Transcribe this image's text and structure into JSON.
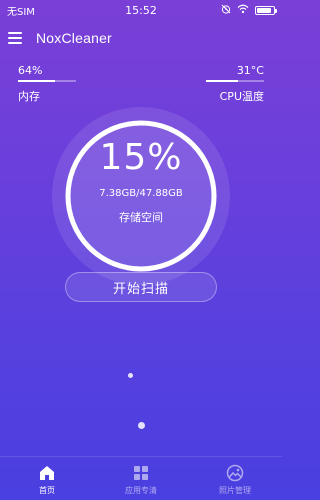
{
  "status_bar": {
    "carrier": "无SIM",
    "time": "15:52",
    "battery_level": 0.85
  },
  "app_bar": {
    "title": "NoxCleaner",
    "menu_icon": "hamburger-menu-icon"
  },
  "metrics": {
    "memory": {
      "value": "64%",
      "label": "内存",
      "level": 0.64
    },
    "cpu_temp": {
      "value": "31°C",
      "label": "CPU温度",
      "level": 0.55
    }
  },
  "storage_gauge": {
    "percent_text": "15%",
    "usage_text": "7.38GB/47.88GB",
    "label": "存储空间",
    "level": 0.15
  },
  "scan_button": {
    "label": "开始扫描"
  },
  "bottom_nav": {
    "items": [
      {
        "label": "首页",
        "icon": "home-icon",
        "active": true
      },
      {
        "label": "应用专清",
        "icon": "grid-apps-icon",
        "active": false
      },
      {
        "label": "照片管理",
        "icon": "photo-icon",
        "active": false
      }
    ]
  },
  "colors": {
    "bg_top": "#7a3fd6",
    "bg_bottom": "#4a3fe0",
    "foreground": "#ffffff"
  }
}
